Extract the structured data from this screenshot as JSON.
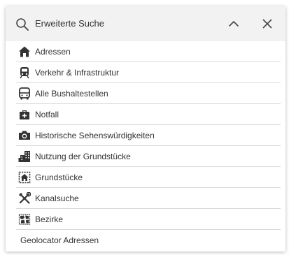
{
  "header": {
    "title": "Erweiterte Suche",
    "search_icon": "search-icon",
    "collapse_icon": "chevron-up-icon",
    "close_icon": "close-icon"
  },
  "items": [
    {
      "label": "Adressen",
      "icon": "home-icon"
    },
    {
      "label": "Verkehr & Infrastruktur",
      "icon": "train-icon"
    },
    {
      "label": "Alle Bushaltestellen",
      "icon": "bus-icon"
    },
    {
      "label": "Notfall",
      "icon": "medkit-icon"
    },
    {
      "label": "Historische Sehenswürdigkeiten",
      "icon": "camera-icon"
    },
    {
      "label": "Nutzung der Grundstücke",
      "icon": "buildings-icon"
    },
    {
      "label": "Grundstücke",
      "icon": "parcel-home-icon"
    },
    {
      "label": "Kanalsuche",
      "icon": "tools-icon"
    },
    {
      "label": "Bezirke",
      "icon": "districts-map-icon"
    },
    {
      "label": "Geolocator Adressen",
      "icon": ""
    }
  ],
  "colors": {
    "header_bg": "#f2f2f2",
    "text": "#333333",
    "icon": "#333333",
    "divider": "#d9d9d9"
  }
}
